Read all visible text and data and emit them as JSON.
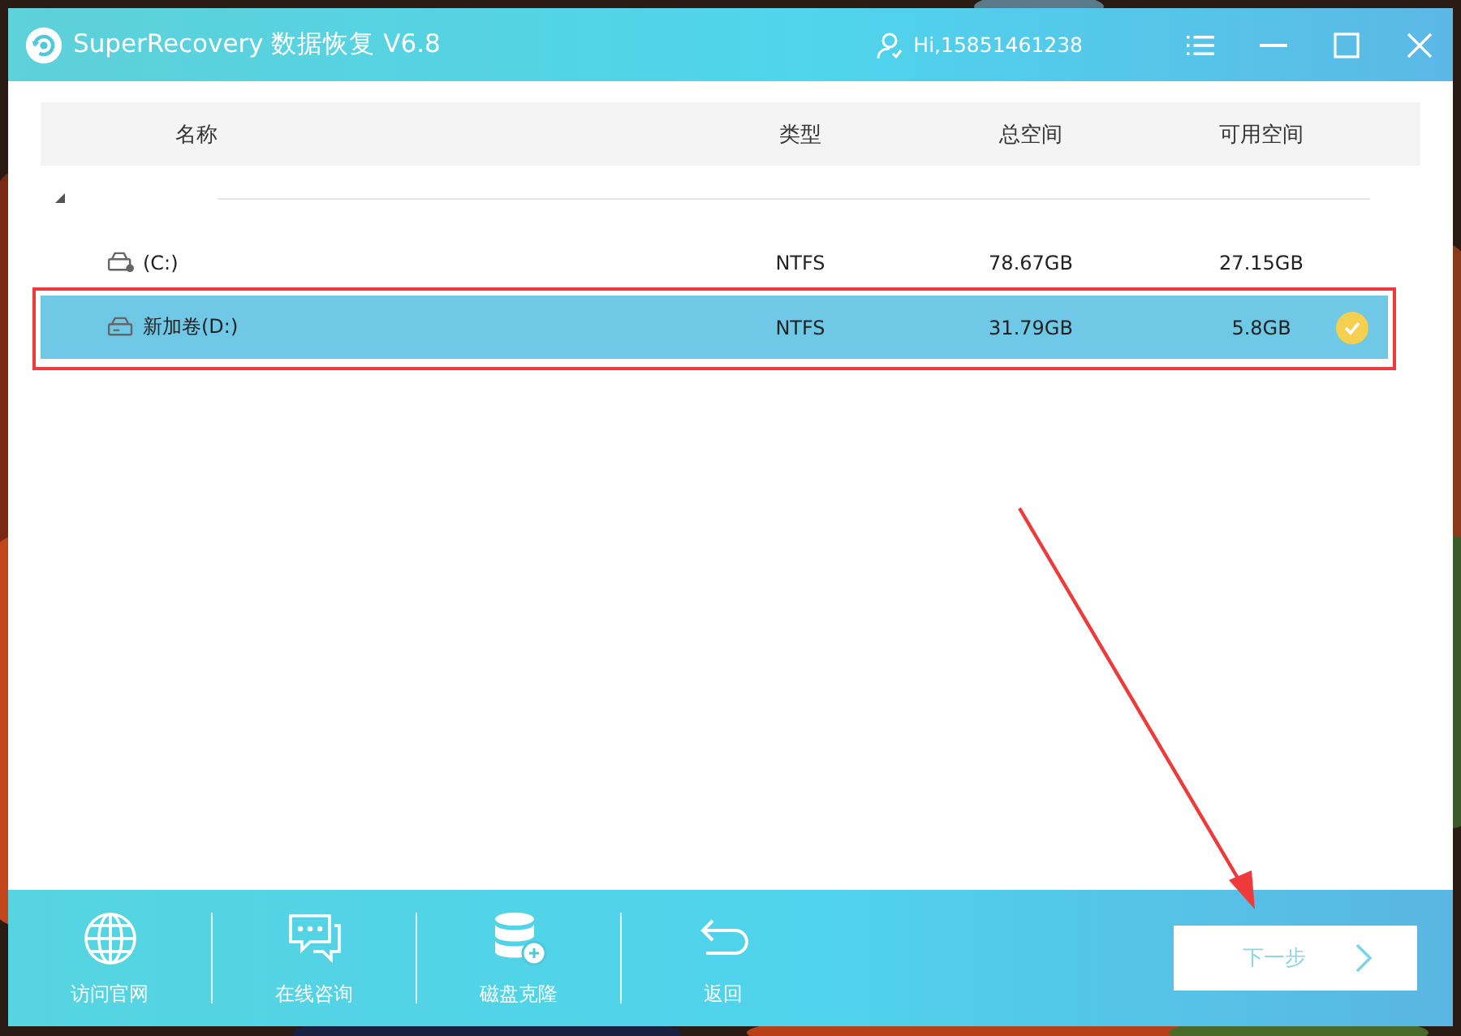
{
  "window": {
    "title": "SuperRecovery 数据恢复 V6.8",
    "user": "Hi,15851461238"
  },
  "table": {
    "columns": [
      "名称",
      "类型",
      "总空间",
      "可用空间"
    ],
    "groups": [
      {
        "expanded": true,
        "children": [
          {
            "kind": "system",
            "name": "(C:)",
            "type": "NTFS",
            "total": "78.67GB",
            "free": "27.15GB",
            "selected": false,
            "highlighted": false
          },
          {
            "kind": "volume",
            "name": "新加卷(D:)",
            "type": "NTFS",
            "total": "31.79GB",
            "free": "5.8GB",
            "selected": true,
            "highlighted": true
          }
        ]
      }
    ]
  },
  "toolbar": [
    {
      "kind": "globe",
      "label": "访问官网"
    },
    {
      "kind": "chat",
      "label": "在线咨询"
    },
    {
      "kind": "disk",
      "label": "磁盘克隆"
    },
    {
      "kind": "back",
      "label": "返回"
    }
  ],
  "next_button": {
    "label": "下一步"
  }
}
